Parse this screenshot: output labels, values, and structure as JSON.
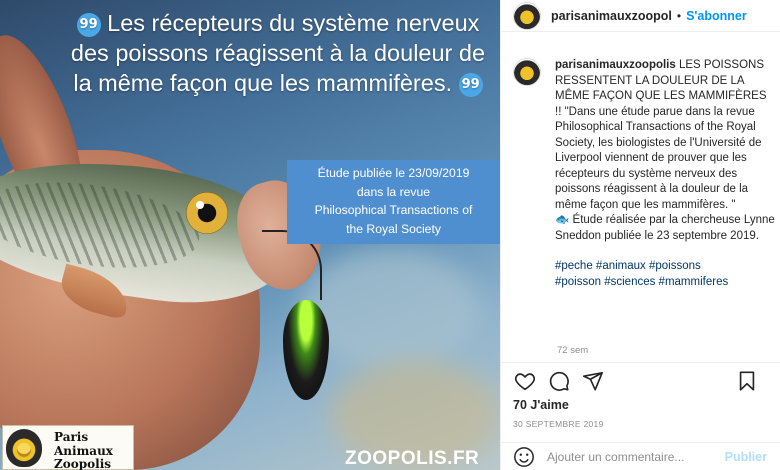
{
  "post": {
    "headline_text": "Les récepteurs du système nerveux des poissons réagissent à la douleur de la même façon que les mammifères.",
    "quote_glyph": "99",
    "study_line1": "Étude publiée le 23/09/2019",
    "study_line2": "dans la revue",
    "study_line3": "Philosophical Transactions of",
    "study_line4": "the Royal Society",
    "logo_line1": "Paris",
    "logo_line2": "Animaux",
    "logo_line3": "Zoopolis",
    "watermark": "ZOOPOLIS.FR"
  },
  "header": {
    "username": "parisanimauxzoopol",
    "separator": "•",
    "follow_label": "S'abonner"
  },
  "caption": {
    "username": "parisanimauxzoopolis",
    "title": "LES POISSONS RESSENTENT LA DOULEUR DE LA MÊME FAÇON QUE LES MAMMIFÈRES",
    "body": "!! \"Dans une étude parue dans la revue Philosophical Transactions of the Royal Society, les biologistes de l'Université de Liverpool viennent de prouver que les récepteurs du système nerveux des poissons réagissent à la douleur de la même façon que les mammifères. \"",
    "study_note": "Étude réalisée par la chercheuse Lynne Sneddon publiée le 23 septembre 2019.",
    "tags_line1": "#peche #animaux #poissons",
    "tags_line2": "#poisson #sciences #mammiferes",
    "time_ago": "72 sem"
  },
  "stats": {
    "likes": "70 J'aime",
    "date": "30 SEPTEMBRE 2019"
  },
  "comment": {
    "placeholder": "Ajouter un commentaire...",
    "publish_label": "Publier"
  },
  "icons": {
    "heart": "heart-icon",
    "comment": "comment-icon",
    "share": "share-icon",
    "bookmark": "bookmark-icon",
    "emoji": "emoji-icon",
    "fish_emoji": "🐟"
  },
  "colors": {
    "accent": "#0095f6",
    "study_box": "#4f8fd0",
    "quote_badge": "#4aa8e8",
    "tag_link": "#00376b"
  }
}
